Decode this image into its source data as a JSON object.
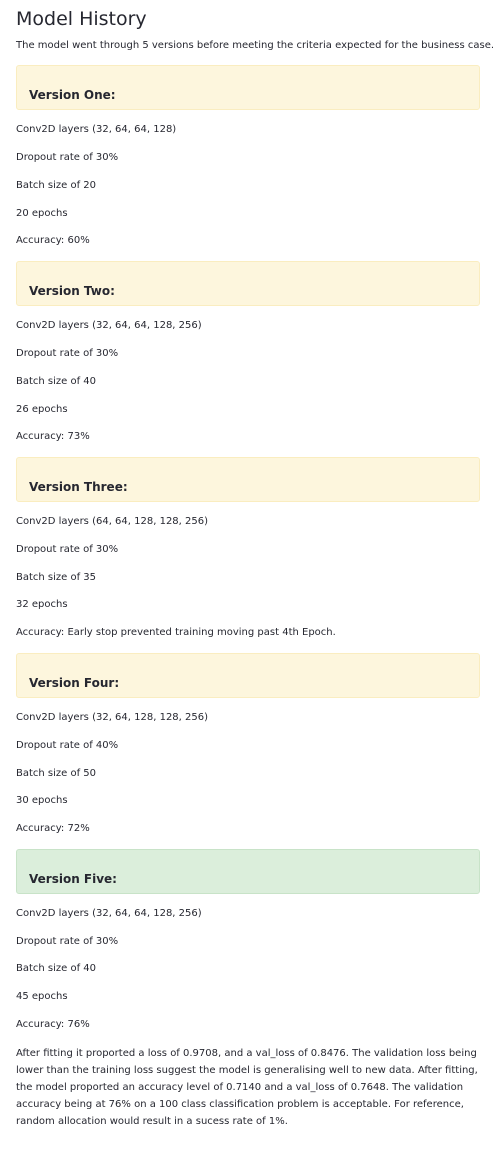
{
  "page": {
    "title": "Model History",
    "intro": "The model went through 5 versions before meeting the criteria expected for the business case."
  },
  "versions": [
    {
      "title": "Version One:",
      "layers": "Conv2D layers (32, 64, 64, 128)",
      "dropout": "Dropout rate of 30%",
      "batch": "Batch size of 20",
      "epochs": "20 epochs",
      "accuracy": "Accuracy: 60%"
    },
    {
      "title": "Version Two:",
      "layers": "Conv2D layers (32, 64, 64, 128, 256)",
      "dropout": "Dropout rate of 30%",
      "batch": "Batch size of 40",
      "epochs": "26 epochs",
      "accuracy": "Accuracy: 73%"
    },
    {
      "title": "Version Three:",
      "layers": "Conv2D layers (64, 64, 128, 128, 256)",
      "dropout": "Dropout rate of 30%",
      "batch": "Batch size of 35",
      "epochs": "32 epochs",
      "accuracy": "Accuracy: Early stop prevented training moving past 4th Epoch."
    },
    {
      "title": "Version Four:",
      "layers": "Conv2D layers (32, 64, 128, 128, 256)",
      "dropout": "Dropout rate of 40%",
      "batch": "Batch size of 50",
      "epochs": "30 epochs",
      "accuracy": "Accuracy: 72%"
    },
    {
      "title": "Version Five:",
      "layers": "Conv2D layers (32, 64, 64, 128, 256)",
      "dropout": "Dropout rate of 30%",
      "batch": "Batch size of 40",
      "epochs": "45 epochs",
      "accuracy": "Accuracy: 76%"
    }
  ],
  "conclusion": "After fitting it proported a loss of 0.9708, and a val_loss of 0.8476. The validation loss being lower than the training loss suggest the model is generalising well to new data. After fitting, the model proported an accuracy level of 0.7140 and a val_loss of 0.7648. The validation accuracy being at 76% on a 100 class classification problem is acceptable. For reference, random allocation would result in a sucess rate of 1%.",
  "colors": {
    "warning_box": "#fdf6dd",
    "success_box": "#dbeedb",
    "text": "#262730"
  }
}
